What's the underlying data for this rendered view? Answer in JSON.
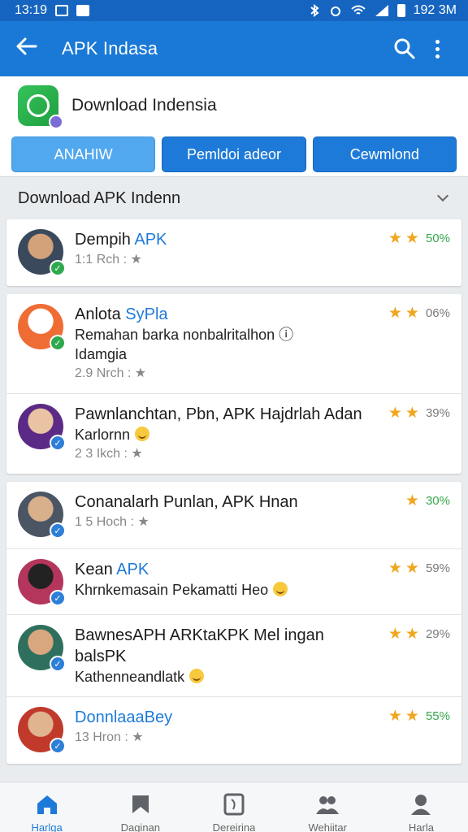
{
  "colors": {
    "status_bar": "#1565c0",
    "app_bar": "#1a79d6",
    "accent": "#1e7ad8",
    "star": "#f0a61e",
    "green": "#36a84c"
  },
  "status_bar": {
    "time": "13:19",
    "clock_right": "192 3M"
  },
  "app_bar": {
    "title": "APK Indasa",
    "back_icon": "arrow-left-icon",
    "search_icon": "search-icon",
    "menu_icon": "more-vert-icon"
  },
  "header": {
    "app_name": "Download Indensia",
    "buttons": [
      "ANAHIW",
      "Pemldoi adeor",
      "Cewmlond"
    ]
  },
  "section": {
    "title": "Download APK Indenn"
  },
  "cards": [
    {
      "items": [
        {
          "name": "Dempih ",
          "name_hl": "APK",
          "desc": "",
          "desc2": "",
          "meta": "1:1 Rch : ★",
          "stars": 2,
          "pct": "50%",
          "pct_color": "green",
          "badge": "green"
        }
      ]
    },
    {
      "items": [
        {
          "name": "Anlota ",
          "name_hl": "SyPla",
          "desc": "Remahan barka nonbalritalhon ⓘ",
          "desc2": "Idamgia",
          "meta": "2.9 Nrch : ★",
          "stars": 2,
          "pct": "06%",
          "pct_color": "gray",
          "badge": "green"
        },
        {
          "name": "Pawnlanchtan, Pbn, APK Hajdrlah Adan",
          "name_hl": "",
          "desc": "Karlornn",
          "desc2": "",
          "meta": "2 3 Ikch : ★",
          "stars": 2,
          "pct": "39%",
          "pct_color": "gray",
          "badge": "blue"
        }
      ]
    },
    {
      "items": [
        {
          "name": "Conanalarh Punlan, APK Hnan",
          "name_hl": "",
          "desc": "",
          "desc2": "",
          "meta": "1 5 Hoch : ★",
          "stars": 1,
          "pct": "30%",
          "pct_color": "green",
          "badge": "blue"
        },
        {
          "name": "Kean ",
          "name_hl": "APK",
          "desc": "Khrnkemasain Pekamatti Heo",
          "desc2": "",
          "meta": "",
          "stars": 2,
          "pct": "59%",
          "pct_color": "gray",
          "badge": "blue"
        },
        {
          "name": "BawnesAPH ARKtaKPK Mel ingan balsPK",
          "name_hl": "",
          "desc": "Kathenneandlatk",
          "desc2": "",
          "meta": "",
          "stars": 2,
          "pct": "29%",
          "pct_color": "gray",
          "badge": "blue"
        },
        {
          "name": "",
          "name_hl": "DonnlaaaBey",
          "desc": "",
          "desc2": "",
          "meta": "13 Hron : ★",
          "stars": 2,
          "pct": "55%",
          "pct_color": "green",
          "badge": "blue"
        }
      ]
    }
  ],
  "bottom_nav": [
    {
      "label": "Harlga",
      "icon": "home-icon",
      "active": true
    },
    {
      "label": "Daginan",
      "icon": "bookmark-icon",
      "active": false
    },
    {
      "label": "Dereirina",
      "icon": "phone-icon",
      "active": false
    },
    {
      "label": "Wehiitar",
      "icon": "people-icon",
      "active": false
    },
    {
      "label": "Harla",
      "icon": "person-icon",
      "active": false
    }
  ]
}
